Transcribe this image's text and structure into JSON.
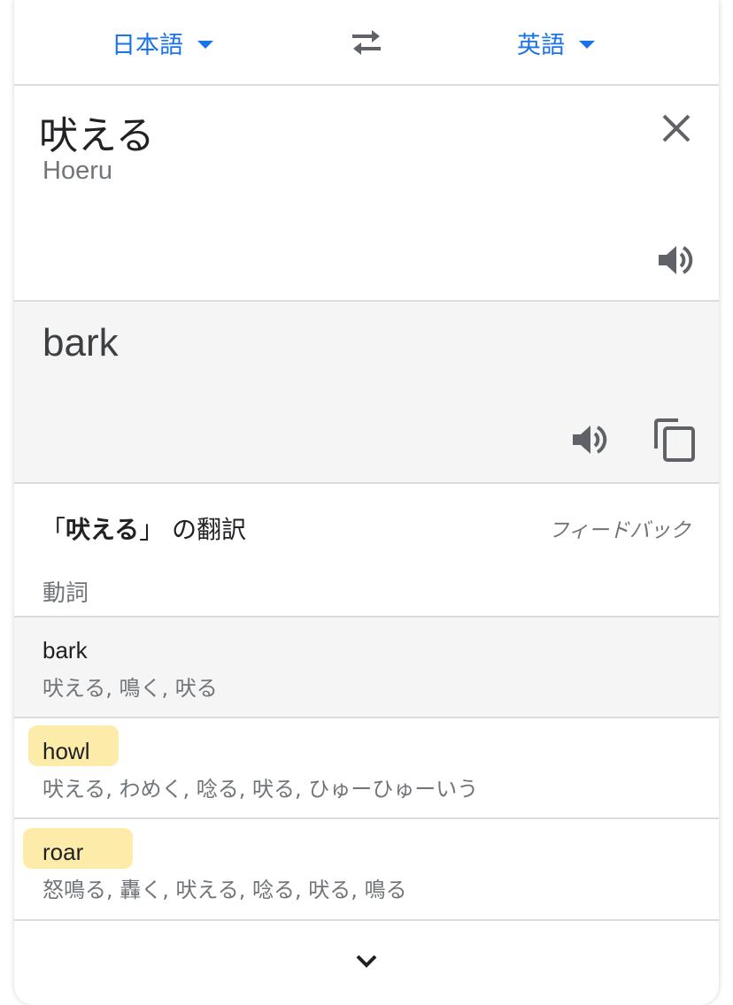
{
  "lang_bar": {
    "source_lang": "日本語",
    "target_lang": "英語",
    "swap_icon": "swap-arrows-icon",
    "accent_color": "#1a73e8"
  },
  "source": {
    "text": "吠える",
    "romanization": "Hoeru",
    "clear_icon": "close-icon",
    "speaker_icon": "speaker-icon"
  },
  "target": {
    "text": "bark",
    "speaker_icon": "speaker-icon",
    "copy_icon": "copy-icon"
  },
  "translations": {
    "title_open": "「",
    "title_word": "吠える",
    "title_close": "」",
    "title_suffix": " の翻訳",
    "feedback": "フィードバック",
    "part_of_speech": "動詞",
    "entries": [
      {
        "word": "bark",
        "synonyms": "吠える, 鳴く, 吠る",
        "highlighted": false
      },
      {
        "word": "howl",
        "synonyms": "吠える, わめく, 唸る, 吠る, ひゅーひゅーいう",
        "highlighted": true
      },
      {
        "word": "roar",
        "synonyms": "怒鳴る, 轟く, 吠える, 唸る, 吠る, 鳴る",
        "highlighted": true
      }
    ],
    "highlight_color": "#fde79a",
    "expand_icon": "chevron-down-icon"
  }
}
